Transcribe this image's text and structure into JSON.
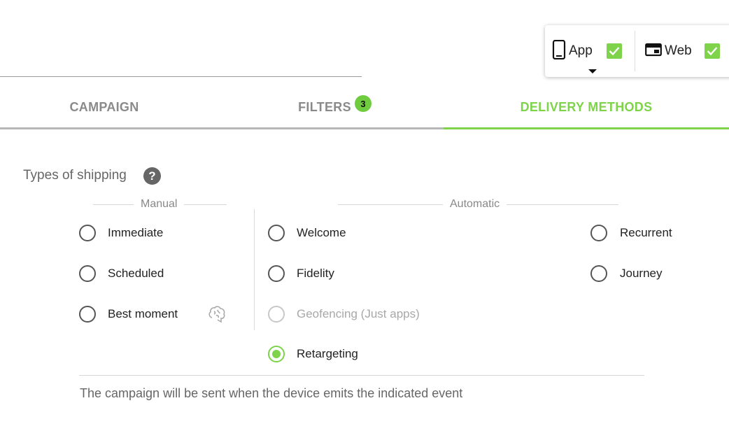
{
  "platforms": {
    "app": {
      "label": "App",
      "icon": "smartphone-icon",
      "checked": true
    },
    "web": {
      "label": "Web",
      "icon": "browser-window-icon",
      "checked": true
    }
  },
  "tabs": [
    {
      "label": "CAMPAIGN",
      "active": false
    },
    {
      "label": "FILTERS",
      "badge": "3",
      "active": false
    },
    {
      "label": "DELIVERY METHODS",
      "active": true
    }
  ],
  "section": {
    "title": "Types of shipping",
    "help_icon": "help-icon"
  },
  "groups": {
    "manual": {
      "title": "Manual"
    },
    "automatic": {
      "title": "Automatic"
    }
  },
  "options": {
    "immediate": {
      "label": "Immediate",
      "selected": false
    },
    "scheduled": {
      "label": "Scheduled",
      "selected": false
    },
    "best_moment": {
      "label": "Best moment",
      "selected": false,
      "icon": "brain-icon"
    },
    "welcome": {
      "label": "Welcome",
      "selected": false
    },
    "fidelity": {
      "label": "Fidelity",
      "selected": false
    },
    "geofencing": {
      "label": "Geofencing (Just apps)",
      "selected": false,
      "disabled": true
    },
    "retargeting": {
      "label": "Retargeting",
      "selected": true
    },
    "recurrent": {
      "label": "Recurrent",
      "selected": false
    },
    "journey": {
      "label": "Journey",
      "selected": false
    }
  },
  "description": "The campaign will be sent when the device emits the indicated event",
  "colors": {
    "accent": "#7ed34a",
    "badge": "#6fcc3f",
    "tab_inactive": "#8a8a8a",
    "text_muted": "#666666"
  }
}
